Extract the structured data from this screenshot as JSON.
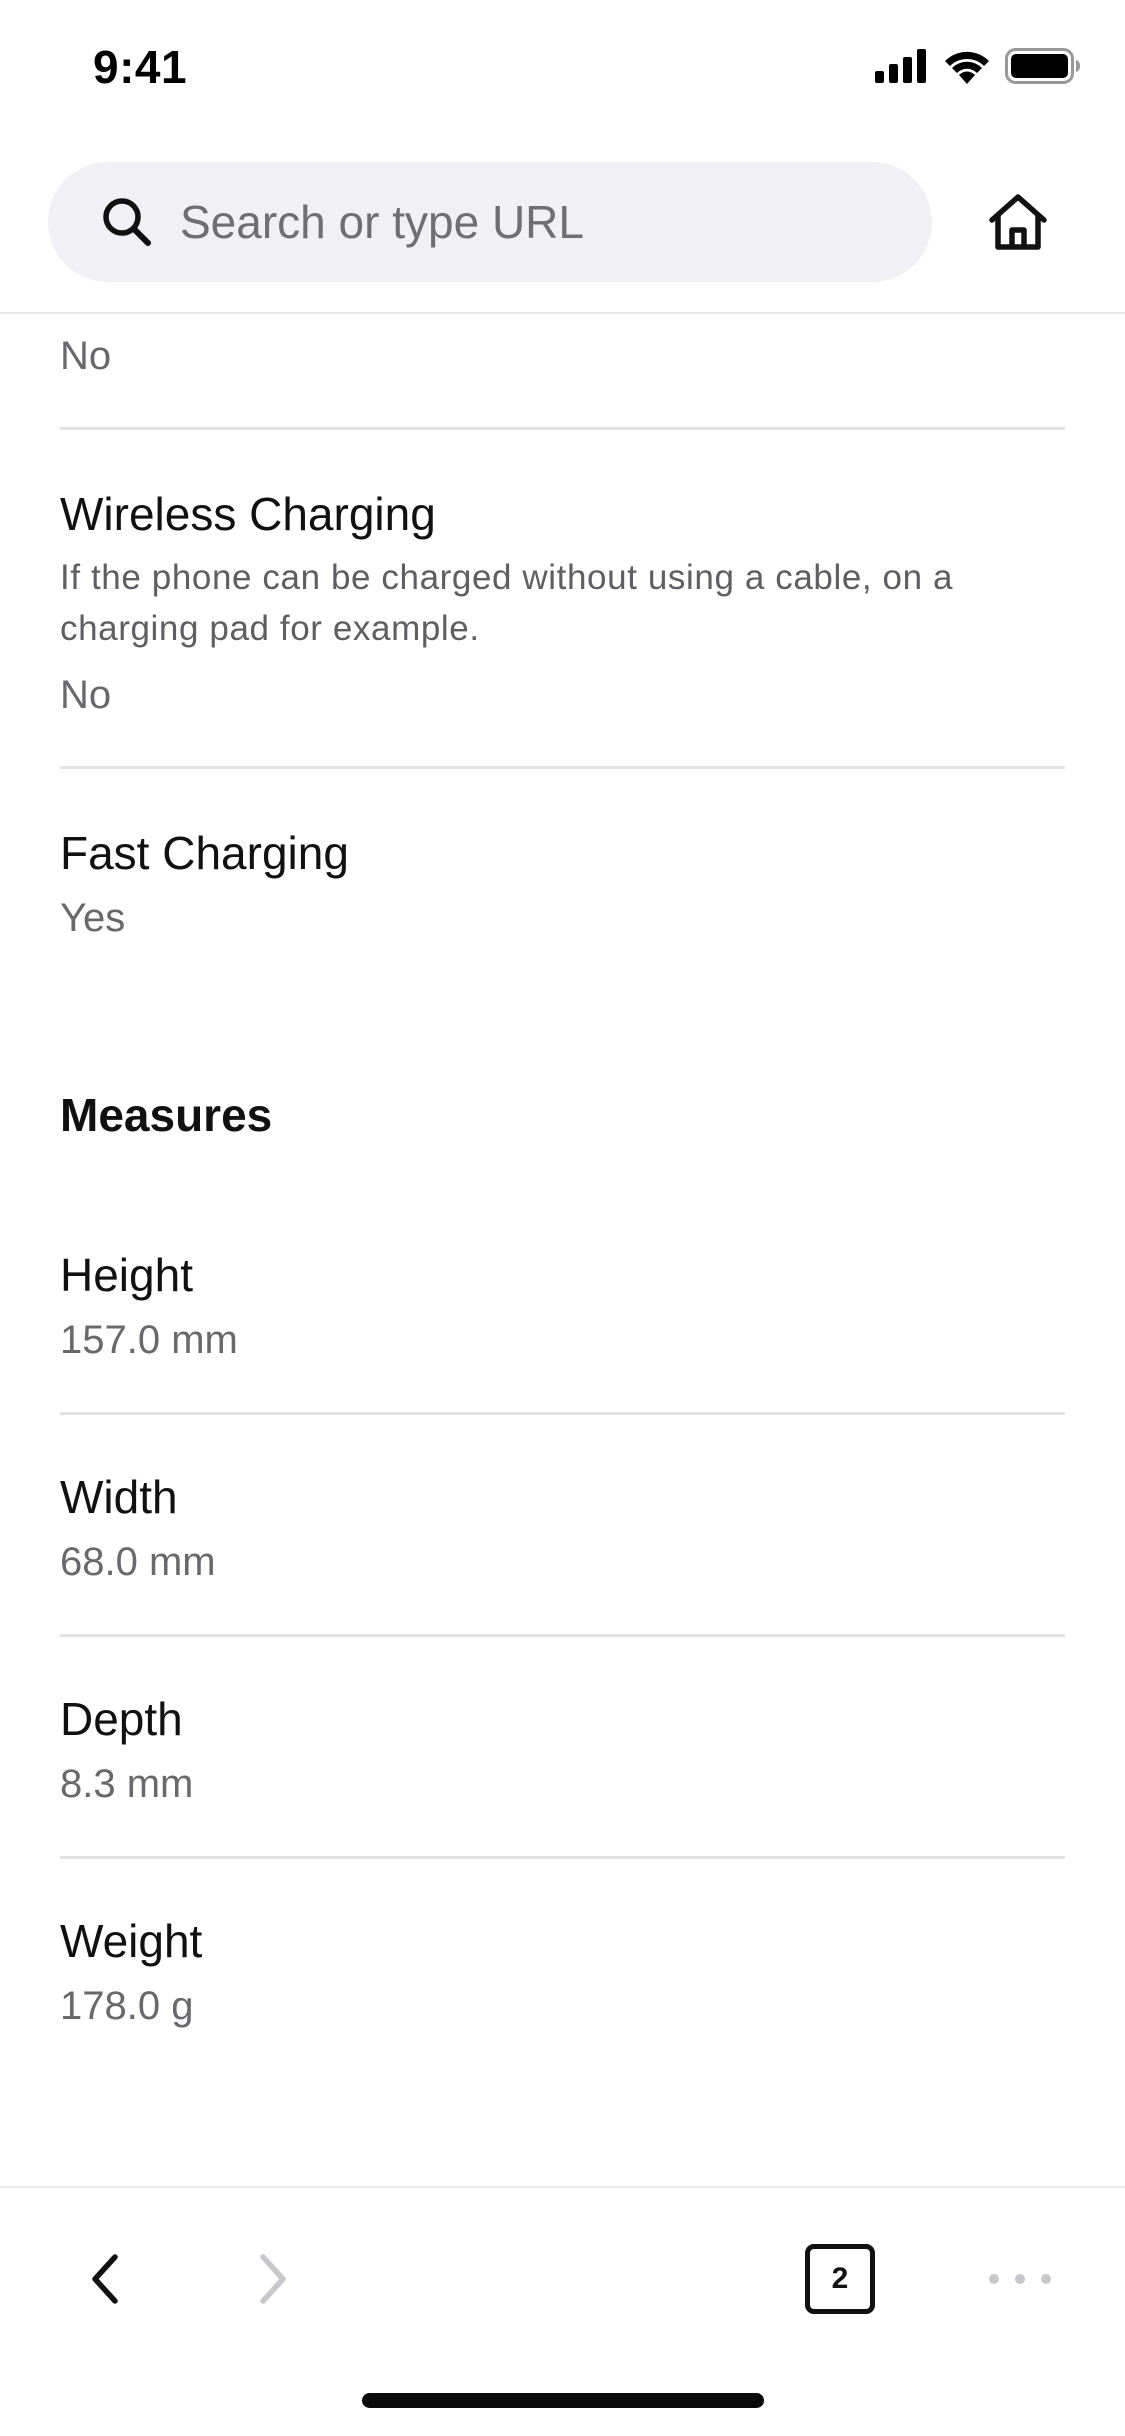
{
  "status_bar": {
    "time": "9:41"
  },
  "browser": {
    "search_placeholder": "Search or type URL",
    "tab_count": "2"
  },
  "specs": {
    "previous_value": "No",
    "wireless_charging": {
      "title": "Wireless Charging",
      "description": "If the phone can be charged without using a cable, on a charging pad for example.",
      "value": "No"
    },
    "fast_charging": {
      "title": "Fast Charging",
      "value": "Yes"
    }
  },
  "measures": {
    "heading": "Measures",
    "items": [
      {
        "title": "Height",
        "value": "157.0 mm"
      },
      {
        "title": "Width",
        "value": "68.0 mm"
      },
      {
        "title": "Depth",
        "value": "8.3 mm"
      },
      {
        "title": "Weight",
        "value": "178.0 g"
      }
    ]
  },
  "icons": {
    "search": "search-icon",
    "home": "home-icon",
    "back": "chevron-left-icon",
    "forward": "chevron-right-icon",
    "tabs": "tabs-icon",
    "more": "more-icon",
    "signal": "cellular-signal-icon",
    "wifi": "wifi-icon",
    "battery": "battery-icon"
  },
  "colors": {
    "url_bar_bg": "#f0f0f5",
    "text_primary": "#111111",
    "text_secondary": "#68686d",
    "disabled_icon": "#c7c7cc"
  }
}
